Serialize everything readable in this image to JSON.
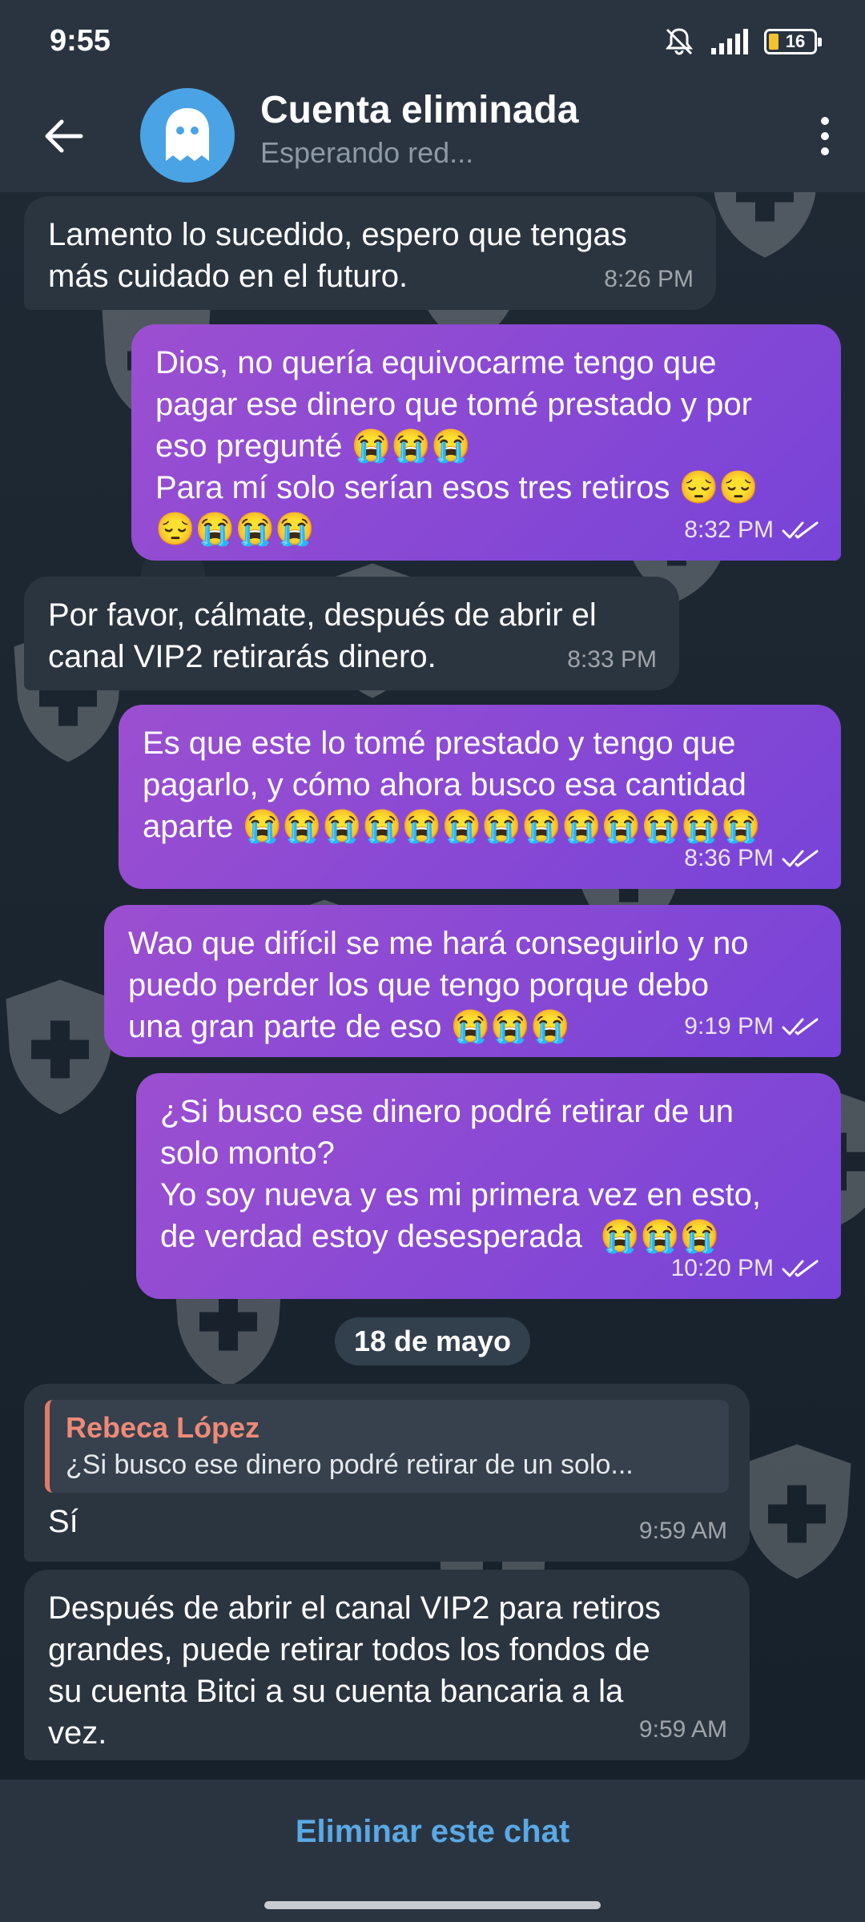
{
  "status_bar": {
    "time": "9:55",
    "battery": "16"
  },
  "header": {
    "title": "Cuenta eliminada",
    "status": "Esperando red..."
  },
  "messages": [
    {
      "dir": "in",
      "text": "Lamento lo sucedido, espero que tengas\nmás cuidado en el futuro.",
      "time": "8:26 PM"
    },
    {
      "dir": "out",
      "text": "Dios, no quería equivocarme tengo que\npagar ese dinero que tomé prestado y por\neso pregunté 😭😭😭\nPara mí solo serían esos tres retiros 😔😔\n😔😭😭😭",
      "time": "8:32 PM",
      "read": true
    },
    {
      "dir": "in",
      "text": "Por favor, cálmate, después de abrir el\ncanal VIP2 retirarás dinero.",
      "time": "8:33 PM"
    },
    {
      "dir": "out",
      "text": "Es que este lo tomé prestado y tengo que\npagarlo, y cómo ahora busco esa cantidad\naparte 😭😭😭😭😭😭😭😭😭😭😭😭😭",
      "time": "8:36 PM",
      "read": true
    },
    {
      "dir": "out",
      "text": "Wao que difícil se me hará conseguirlo y no\npuedo perder los que tengo porque debo\nuna gran parte de eso 😭😭😭",
      "time": "9:19 PM",
      "read": true
    },
    {
      "dir": "out",
      "text": "¿Si busco ese dinero podré retirar de un\nsolo monto?\nYo soy nueva y es mi primera vez en esto,\nde verdad estoy desesperada  😭😭😭",
      "time": "10:20 PM",
      "read": true
    },
    {
      "dir": "in",
      "reply_to": {
        "name": "Rebeca López",
        "text": "¿Si busco ese dinero podré retirar de un solo..."
      },
      "text": "Sí",
      "time": "9:59 AM"
    },
    {
      "dir": "in",
      "text": "Después de abrir el canal VIP2 para retiros\ngrandes, puede retirar todos los fondos de\nsu cuenta Bitci a su cuenta bancaria a la\nvez.",
      "time": "9:59 AM"
    }
  ],
  "date_separator": "18 de mayo",
  "bottom_bar": {
    "delete_label": "Eliminar este chat"
  },
  "colors": {
    "accent": "#5aa9e6",
    "outgoing": "#8a48d4",
    "incoming": "#2b3540",
    "reply_name": "#ee8a78"
  }
}
